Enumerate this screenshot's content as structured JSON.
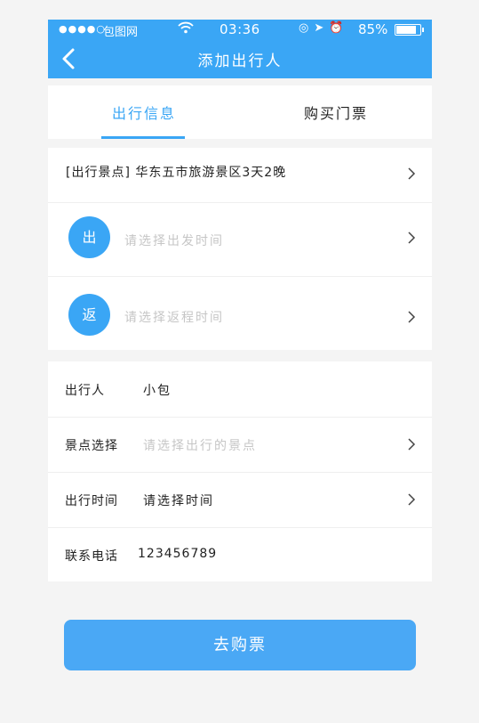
{
  "status": {
    "dots": "●●●●○",
    "carrier": "包图网",
    "time": "03:36",
    "battery": "85%",
    "battery_level": 0.85
  },
  "header": {
    "title": "添加出行人"
  },
  "tabs": [
    {
      "label": "出行信息",
      "active": true
    },
    {
      "label": "购买门票",
      "active": false
    }
  ],
  "trip": {
    "scenic_text": "[出行景点] 华东五市旅游景区3天2晚",
    "depart": {
      "badge": "出",
      "placeholder": "请选择出发时间"
    },
    "return": {
      "badge": "返",
      "placeholder": "请选择返程时间"
    }
  },
  "form": {
    "traveler": {
      "label": "出行人",
      "value": "小包"
    },
    "scenic": {
      "label": "景点选择",
      "placeholder": "请选择出行的景点"
    },
    "time": {
      "label": "出行时间",
      "value": "请选择时间"
    },
    "phone": {
      "label": "联系电话",
      "value": "123456789"
    }
  },
  "buy_button": {
    "label": "去购票"
  },
  "colors": {
    "accent": "#3aa6f5",
    "background": "#f4f4f4",
    "placeholder": "#c6c6c6"
  }
}
